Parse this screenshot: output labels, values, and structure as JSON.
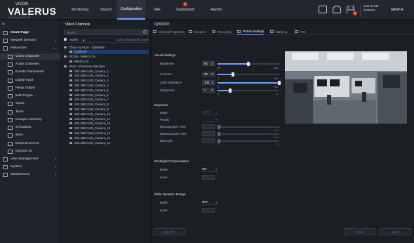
{
  "brand": {
    "sub": "VICON",
    "name": "VALERUS"
  },
  "nav": {
    "monitoring": "Monitoring",
    "search": "Search",
    "configuration": "Configuration",
    "vax": "VAX",
    "dashboard": "Dashboard",
    "alarms": "Alarms",
    "dashboard_badge": "1"
  },
  "topright": {
    "flag_badge": "1",
    "time": "2:52:33 PM",
    "date": "4/4/2021",
    "user": "admin ▾",
    "sep": "—"
  },
  "sidebar": {
    "collapse": "«",
    "items": [
      {
        "label": "Home Page"
      },
      {
        "label": "Network Devices"
      },
      {
        "label": "Resources"
      },
      {
        "label": "Video Channels"
      },
      {
        "label": "Audio Channels"
      },
      {
        "label": "Events Framework"
      },
      {
        "label": "Digital Input"
      },
      {
        "label": "Relay Output"
      },
      {
        "label": "Web Pages"
      },
      {
        "label": "Views"
      },
      {
        "label": "Tours"
      },
      {
        "label": "Groups Hierarchy"
      },
      {
        "label": "Schedules"
      },
      {
        "label": "Sites"
      },
      {
        "label": "External Events"
      },
      {
        "label": "Numeric ID"
      },
      {
        "label": "User Management"
      },
      {
        "label": "System"
      },
      {
        "label": "Maintenance"
      }
    ]
  },
  "tree": {
    "title": "Video Channels",
    "search_placeholder": "Search",
    "col_name": "Name",
    "sort": "▲",
    "grouped": "List is grouped by model",
    "rows": [
      "Cheyo by Vicon - IQ8692W",
      "IQ8692W",
      "VICON - 6WI6CV IX",
      "6WI6CV IX",
      "Vicon - IPDevices Simulator",
      "192.168.0.105_Camera_1",
      "192.168.0.105_Camera_2",
      "192.168.0.105_Camera_3",
      "192.168.0.105_Camera_4",
      "192.168.0.105_Camera_5",
      "192.168.0.105_Camera_6",
      "192.168.0.105_Camera_7",
      "192.168.0.105_Camera_8",
      "192.168.0.105_Camera_9",
      "192.168.0.105_Camera_10",
      "192.168.0.105_Camera_11",
      "192.168.0.105_Camera_12",
      "192.168.0.105_Camera_13",
      "192.168.0.105_Camera_14",
      "192.168.0.105_Camera_15",
      "192.168.0.105_Camera_16"
    ]
  },
  "content": {
    "camera": "IQ8692W",
    "tabs": [
      "Channel Properties",
      "Streams",
      "Recording",
      "Picture Settings",
      "Masking",
      "ROI"
    ],
    "visual": {
      "title": "Visual Settings",
      "brightness": {
        "label": "Brightness",
        "value": "60",
        "min": "20",
        "max": "100",
        "level": 0.5
      },
      "contrast": {
        "label": "Contrast",
        "value": "25",
        "min": "0",
        "max": "100",
        "level": 0.25
      },
      "saturation": {
        "label": "Color Saturation",
        "value": "100",
        "min": "0",
        "max": "100",
        "level": 1.0
      },
      "sharpness": {
        "label": "Sharpness",
        "value": "1",
        "min": "0",
        "max": "5",
        "level": 0.2
      }
    },
    "exposure": {
      "title": "Exposure",
      "mode": {
        "label": "Mode",
        "value": "AUTO"
      },
      "priority": {
        "label": "Priority",
        "value": ""
      },
      "min_time": {
        "label": "Min Exposure Time",
        "value": "",
        "min": "",
        "max": "1000"
      },
      "max_time": {
        "label": "Max Exposure Time",
        "value": "",
        "min": "",
        "max": "1000"
      },
      "max_gain": {
        "label": "Max Gain",
        "value": "",
        "min": "10",
        "max": "30"
      }
    },
    "backlight": {
      "title": "Backlight Compensation",
      "mode": {
        "label": "Mode",
        "value": "ON"
      },
      "level": {
        "label": "Level",
        "value": ""
      }
    },
    "wdr": {
      "title": "Wide Dynamic Range",
      "mode": {
        "label": "Mode",
        "value": "OFF"
      },
      "level": {
        "label": "Level",
        "value": ""
      }
    },
    "buttons": {
      "apply_to": "Apply To...",
      "cancel": "Cancel",
      "save": "Save"
    }
  },
  "colors": {
    "accent": "#6aa3ff",
    "alert": "#e23b2e",
    "selected_row": "#1e3b6b"
  }
}
